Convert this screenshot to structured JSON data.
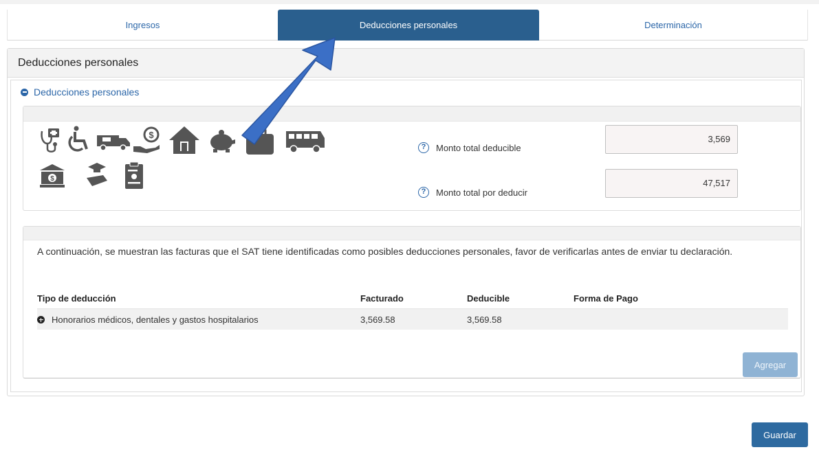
{
  "tabs": [
    {
      "label": "Ingresos",
      "active": false
    },
    {
      "label": "Deducciones personales",
      "active": true
    },
    {
      "label": "Determinación",
      "active": false
    }
  ],
  "panel": {
    "title": "Deducciones personales",
    "section_title": "Deducciones personales"
  },
  "icons": [
    "medical-stethoscope",
    "wheelchair",
    "ambulance",
    "donation-hand",
    "house",
    "piggy-bank",
    "briefcase",
    "school-bus",
    "bank",
    "graduation",
    "clipboard"
  ],
  "totals": {
    "deductible_label": "Monto total deducible",
    "deductible_value": "3,569",
    "to_deduct_label": "Monto total por deducir",
    "to_deduct_value": "47,517"
  },
  "invoices": {
    "notice": "A continuación, se muestran las facturas que el SAT tiene identificadas como posibles deducciones personales, favor de verificarlas antes de enviar tu declaración.",
    "columns": [
      "Tipo de deducción",
      "Facturado",
      "Deducible",
      "Forma de Pago"
    ],
    "rows": [
      {
        "tipo": "Honorarios médicos, dentales y gastos hospitalarios",
        "facturado": "3,569.58",
        "deducible": "3,569.58",
        "forma": ""
      }
    ],
    "add_label": "Agregar"
  },
  "save_label": "Guardar",
  "colors": {
    "primary": "#2a5f8e",
    "link": "#2b66a8",
    "arrow": "#3b6fc6"
  }
}
